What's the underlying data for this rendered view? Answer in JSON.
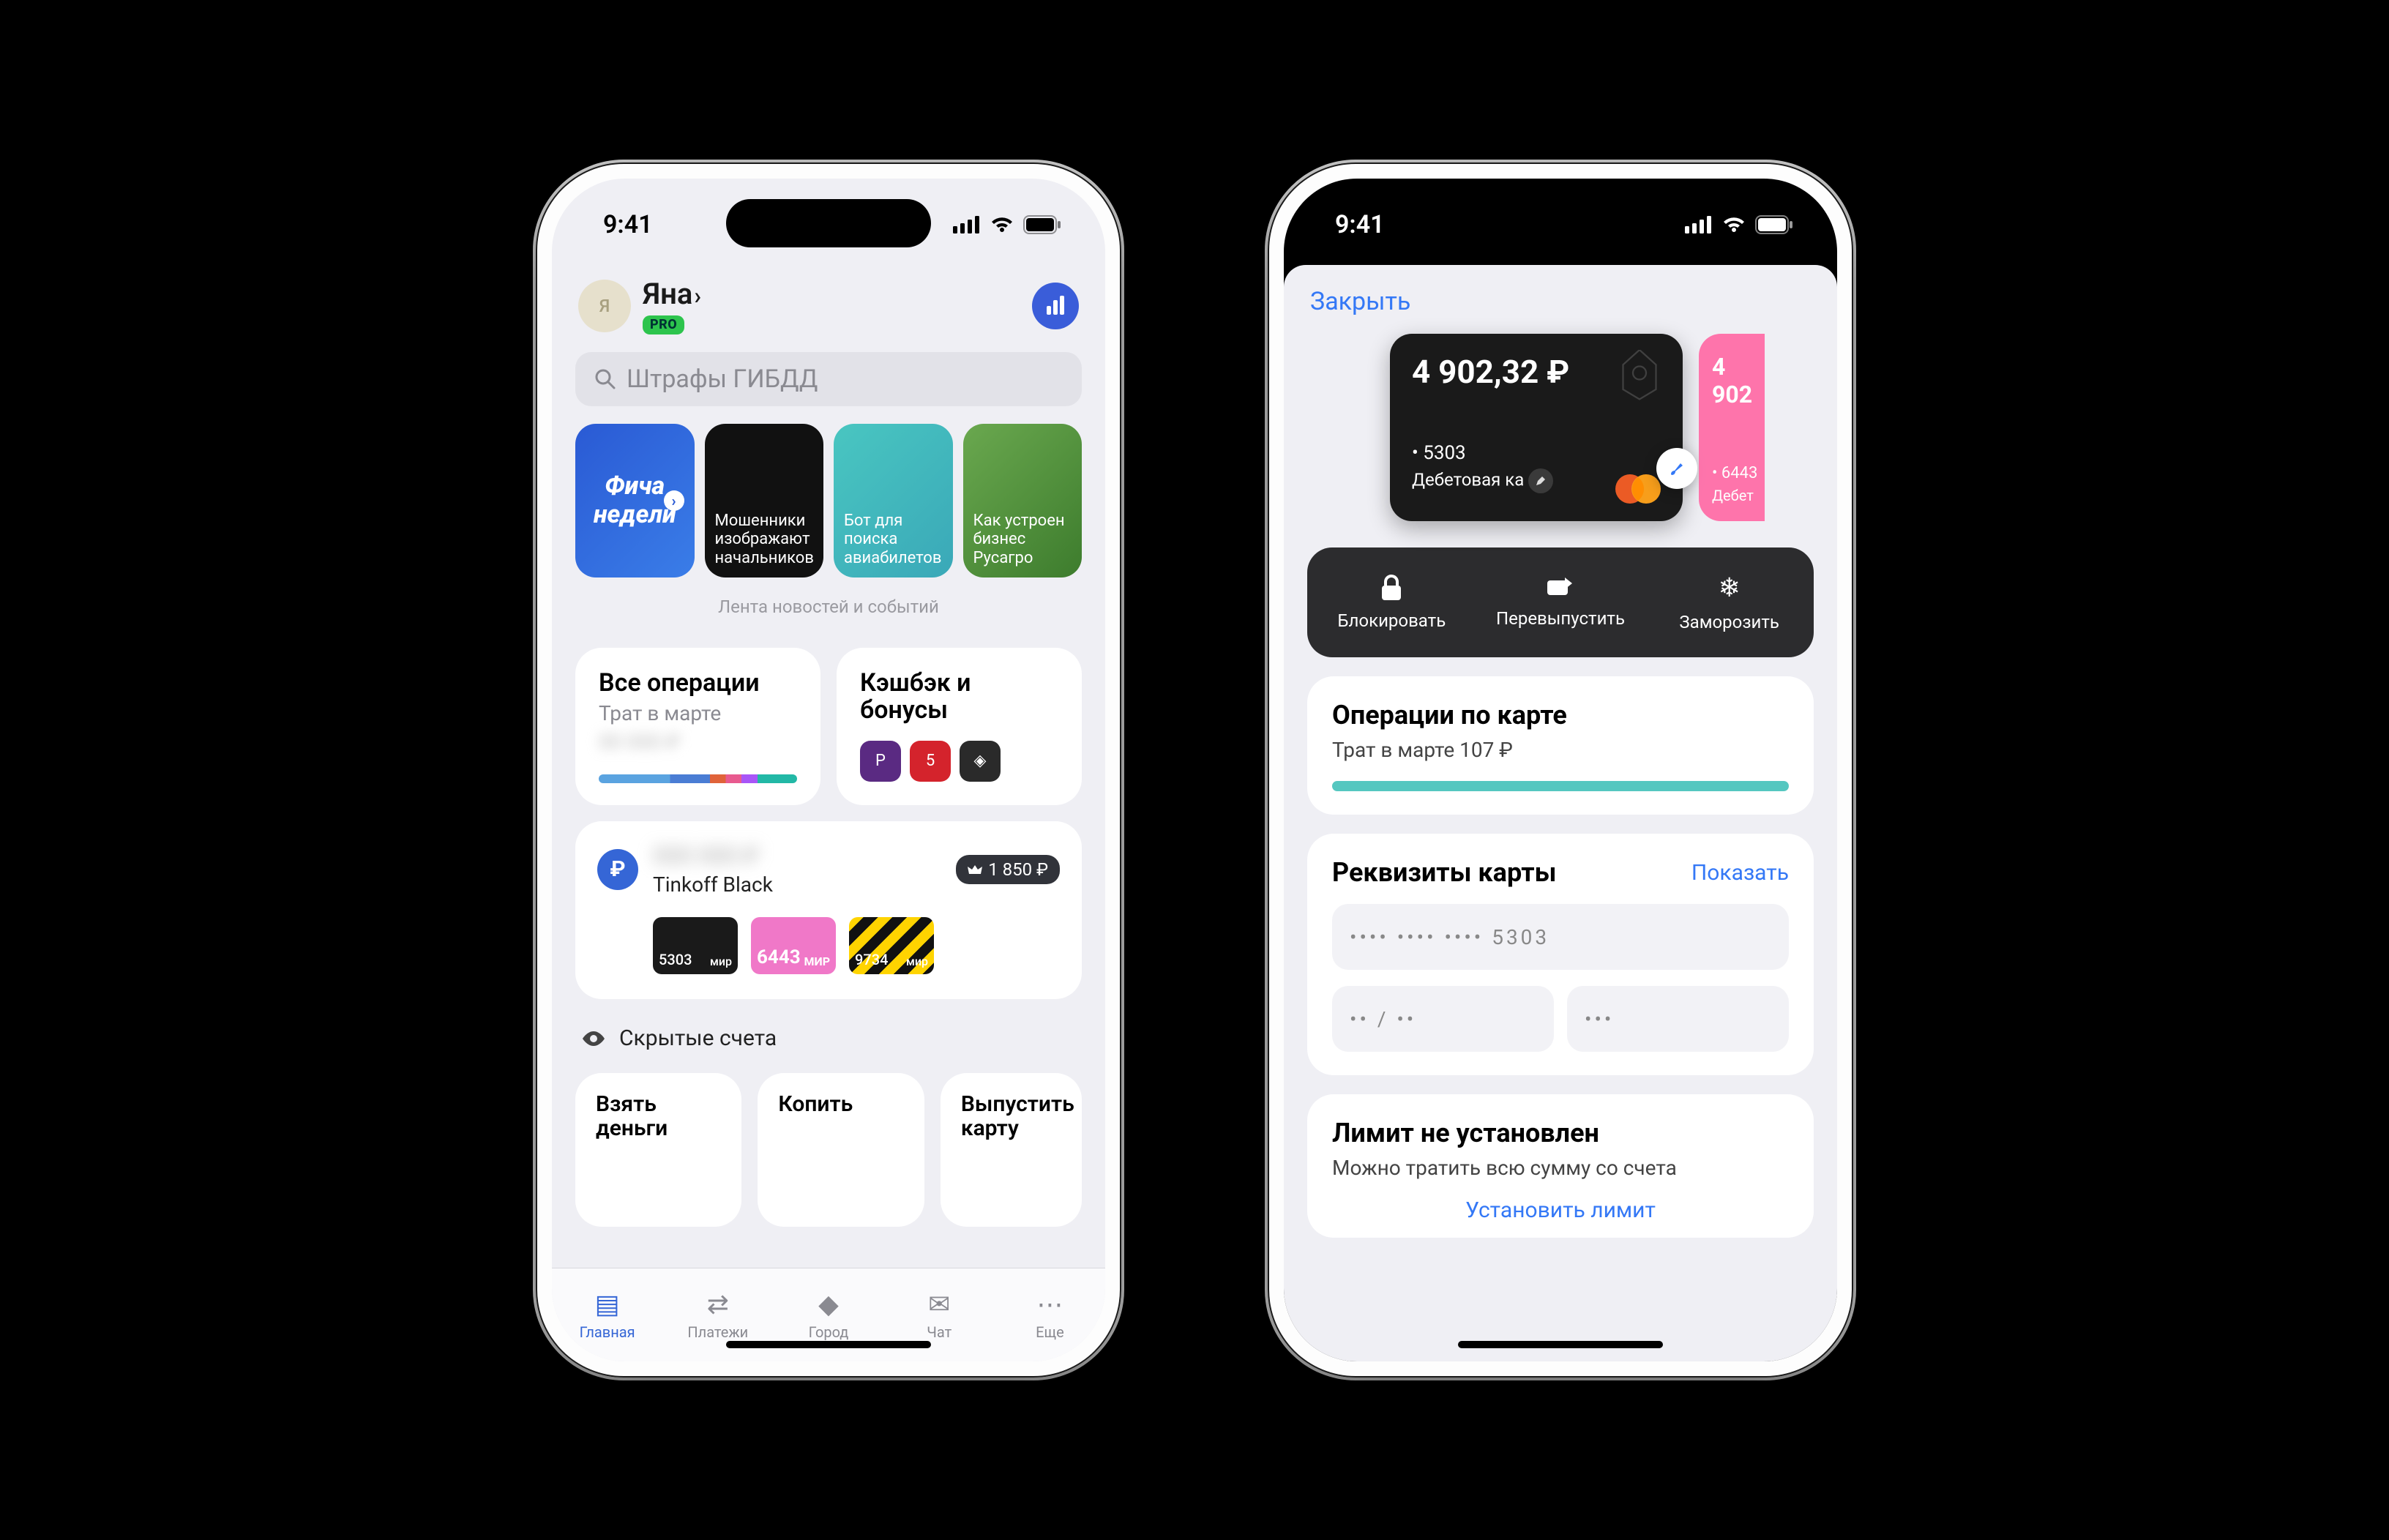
{
  "status": {
    "time": "9:41"
  },
  "phone1": {
    "profile": {
      "initial": "Я",
      "name": "Яна",
      "chev": "›",
      "badge": "PRO"
    },
    "search_placeholder": "Штрафы ГИБДД",
    "stories": [
      {
        "line1": "Фича",
        "line2": "недели"
      },
      {
        "text": "Мошенники изображают начальников"
      },
      {
        "text": "Бот для поиска авиабилетов"
      },
      {
        "text": "Как устроен бизнес Русагро"
      }
    ],
    "feed_label": "Лента новостей и событий",
    "ops": {
      "title": "Все операции",
      "sub": "Трат в марте"
    },
    "cashback": {
      "title": "Кэшбэк и бонусы"
    },
    "account": {
      "name": "Tinkoff Black",
      "badge": "1 850 ₽",
      "cards": [
        {
          "last4": "5303",
          "sys": "мир"
        },
        {
          "last4": "6443",
          "sys": "МИР"
        },
        {
          "last4": "9734",
          "sys": "мир"
        }
      ]
    },
    "hidden": "Скрытые счета",
    "cta": [
      "Взять деньги",
      "Копить",
      "Выпустить карту"
    ],
    "tabs": [
      "Главная",
      "Платежи",
      "Город",
      "Чат",
      "Еще"
    ]
  },
  "phone2": {
    "close": "Закрыть",
    "card": {
      "balance": "4 902,32 ₽",
      "last4": "• 5303",
      "type": "Дебетовая ка"
    },
    "peek": {
      "balance": "4 902",
      "last4": "• 6443",
      "type": "Дебет"
    },
    "actions": [
      "Блокировать",
      "Перевыпустить",
      "Заморозить"
    ],
    "ops": {
      "title": "Операции по карте",
      "sub": "Трат в марте 107 ₽"
    },
    "req": {
      "title": "Реквизиты карты",
      "show": "Показать",
      "num": "•••• •••• •••• 5303",
      "exp": "•• / ••",
      "cvv": "•••"
    },
    "limit": {
      "title": "Лимит не установлен",
      "sub": "Можно тратить всю сумму со счета",
      "action": "Установить лимит"
    }
  }
}
